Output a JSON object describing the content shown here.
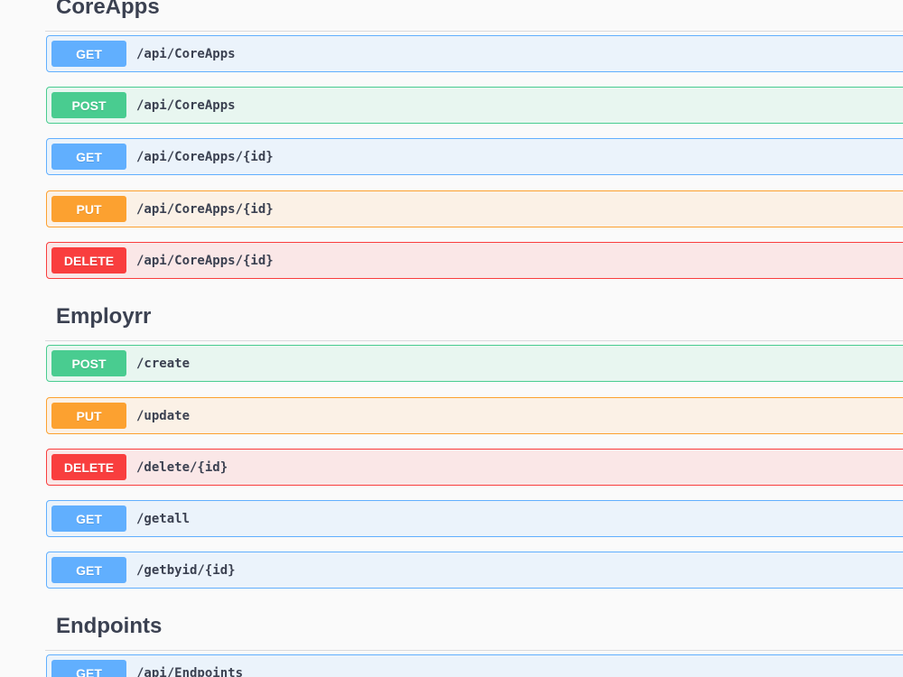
{
  "sections": [
    {
      "title": "CoreApps",
      "operations": [
        {
          "method": "GET",
          "path": "/api/CoreApps"
        },
        {
          "method": "POST",
          "path": "/api/CoreApps"
        },
        {
          "method": "GET",
          "path": "/api/CoreApps/{id}"
        },
        {
          "method": "PUT",
          "path": "/api/CoreApps/{id}"
        },
        {
          "method": "DELETE",
          "path": "/api/CoreApps/{id}"
        }
      ]
    },
    {
      "title": "Employrr",
      "operations": [
        {
          "method": "POST",
          "path": "/create"
        },
        {
          "method": "PUT",
          "path": "/update"
        },
        {
          "method": "DELETE",
          "path": "/delete/{id}"
        },
        {
          "method": "GET",
          "path": "/getall"
        },
        {
          "method": "GET",
          "path": "/getbyid/{id}"
        }
      ]
    },
    {
      "title": "Endpoints",
      "operations": [
        {
          "method": "GET",
          "path": "/api/Endpoints"
        }
      ]
    }
  ],
  "method_colors": {
    "GET": "#61affe",
    "POST": "#49cc90",
    "PUT": "#fca130",
    "DELETE": "#f93e3e"
  }
}
